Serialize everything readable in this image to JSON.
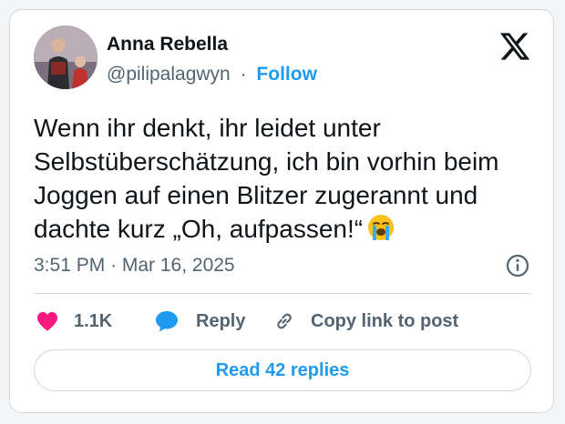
{
  "author": {
    "display_name": "Anna Rebella",
    "handle": "@pilipalagwyn",
    "separator": "·",
    "follow_label": "Follow",
    "avatar_icon": "profile-photo"
  },
  "platform": {
    "logo_icon": "x-logo"
  },
  "tweet": {
    "text": "Wenn ihr denkt, ihr leidet unter Selbstüberschätzung, ich bin vorhin beim Joggen auf einen Blitzer zugerannt und dachte kurz „Oh, aufpassen!“",
    "emoji_icon": "loudly-crying-face-emoji",
    "timestamp": "3:51 PM · Mar 16, 2025",
    "info_icon": "info-circle-icon"
  },
  "actions": {
    "like_count": "1.1K",
    "reply_label": "Reply",
    "copy_link_label": "Copy link to post",
    "read_replies_label": "Read 42 replies"
  },
  "colors": {
    "accent": "#1d9bf0",
    "like": "#f91880",
    "text_primary": "#0f1419",
    "text_secondary": "#536471",
    "border": "#cfd9de"
  }
}
